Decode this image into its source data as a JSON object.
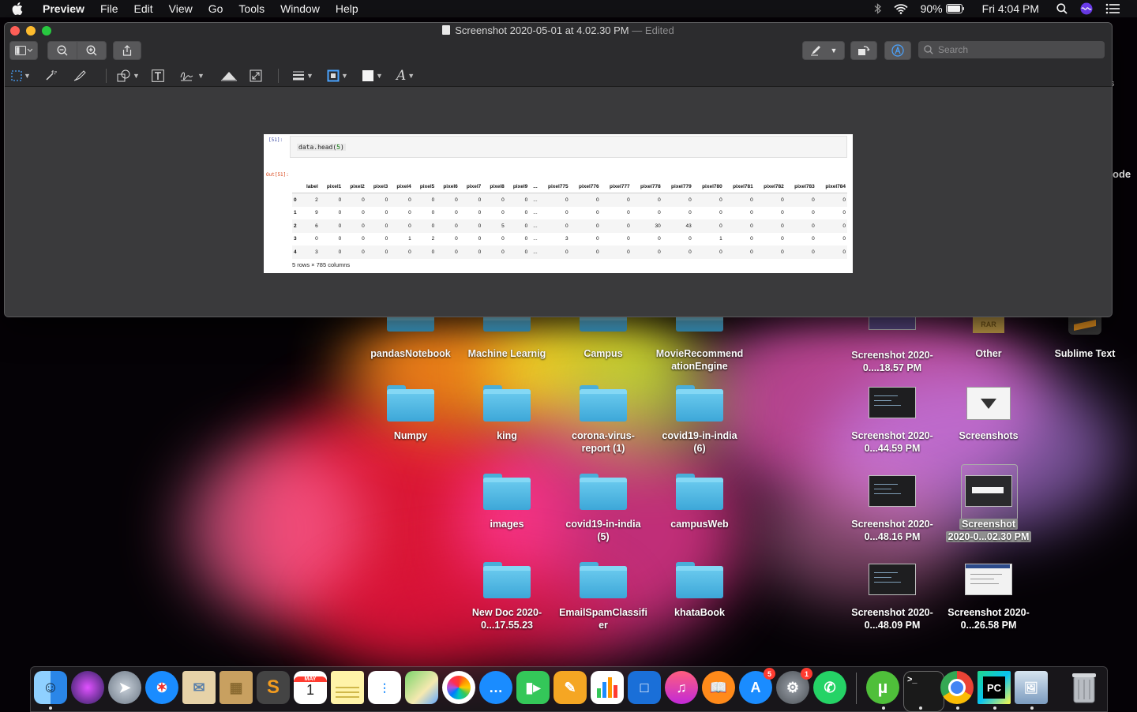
{
  "menubar": {
    "app": "Preview",
    "items": [
      "File",
      "Edit",
      "View",
      "Go",
      "Tools",
      "Window",
      "Help"
    ],
    "battery": "90%",
    "clock": "Fri 4:04 PM"
  },
  "window": {
    "title": "Screenshot 2020-05-01 at 4.02.30 PM",
    "edited": "— Edited",
    "search_placeholder": "Search"
  },
  "notebook": {
    "in_label": "[51]:",
    "code_fn": "data.head(",
    "code_num": "5",
    "code_end": ")",
    "out_label": "Out[51]:",
    "columns": [
      "",
      "label",
      "pixel1",
      "pixel2",
      "pixel3",
      "pixel4",
      "pixel5",
      "pixel6",
      "pixel7",
      "pixel8",
      "pixel9",
      "...",
      "pixel775",
      "pixel776",
      "pixel777",
      "pixel778",
      "pixel779",
      "pixel780",
      "pixel781",
      "pixel782",
      "pixel783",
      "pixel784"
    ],
    "rows": [
      [
        "0",
        "2",
        "0",
        "0",
        "0",
        "0",
        "0",
        "0",
        "0",
        "0",
        "0",
        "...",
        "0",
        "0",
        "0",
        "0",
        "0",
        "0",
        "0",
        "0",
        "0",
        "0"
      ],
      [
        "1",
        "9",
        "0",
        "0",
        "0",
        "0",
        "0",
        "0",
        "0",
        "0",
        "0",
        "...",
        "0",
        "0",
        "0",
        "0",
        "0",
        "0",
        "0",
        "0",
        "0",
        "0"
      ],
      [
        "2",
        "6",
        "0",
        "0",
        "0",
        "0",
        "0",
        "0",
        "0",
        "5",
        "0",
        "...",
        "0",
        "0",
        "0",
        "30",
        "43",
        "0",
        "0",
        "0",
        "0",
        "0"
      ],
      [
        "3",
        "0",
        "0",
        "0",
        "0",
        "1",
        "2",
        "0",
        "0",
        "0",
        "0",
        "...",
        "3",
        "0",
        "0",
        "0",
        "0",
        "1",
        "0",
        "0",
        "0",
        "0"
      ],
      [
        "4",
        "3",
        "0",
        "0",
        "0",
        "0",
        "0",
        "0",
        "0",
        "0",
        "0",
        "...",
        "0",
        "0",
        "0",
        "0",
        "0",
        "0",
        "0",
        "0",
        "0",
        "0"
      ]
    ],
    "rowcount": "5 rows × 785 columns"
  },
  "desktop": {
    "edge_text": "ode",
    "edge_s": "s",
    "items": [
      {
        "label": "pandasNotebook",
        "kind": "folder"
      },
      {
        "label": "Machine Learnig",
        "kind": "folder"
      },
      {
        "label": "Campus",
        "kind": "folder"
      },
      {
        "label": "MovieRecommend ationEngine",
        "kind": "folder"
      },
      {
        "label": "Screenshot 2020-0....18.57 PM",
        "kind": "screenshot"
      },
      {
        "label": "Other",
        "kind": "rar"
      },
      {
        "label": "Sublime Text",
        "kind": "app"
      },
      {
        "label": "Numpy",
        "kind": "folder"
      },
      {
        "label": "king",
        "kind": "folder"
      },
      {
        "label": "corona-virus- report (1)",
        "kind": "folder"
      },
      {
        "label": "covid19-in-india (6)",
        "kind": "folder"
      },
      {
        "label": "Screenshot 2020-0...44.59 PM",
        "kind": "screenshot"
      },
      {
        "label": "Screenshots",
        "kind": "folder-special"
      },
      {
        "label": "images",
        "kind": "folder"
      },
      {
        "label": "covid19-in-india (5)",
        "kind": "folder"
      },
      {
        "label": "campusWeb",
        "kind": "folder"
      },
      {
        "label": "Screenshot 2020-0...48.16 PM",
        "kind": "screenshot"
      },
      {
        "label_line1": "Screenshot",
        "label_line2": "2020-0...02.30 PM",
        "kind": "screenshot-selected"
      },
      {
        "label": "New Doc 2020-0...17.55.23",
        "kind": "folder"
      },
      {
        "label": "EmailSpamClassifi er",
        "kind": "folder"
      },
      {
        "label": "khataBook",
        "kind": "folder"
      },
      {
        "label": "Screenshot 2020-0...48.09 PM",
        "kind": "screenshot"
      },
      {
        "label": "Screenshot 2020-0...26.58 PM",
        "kind": "screenshot"
      }
    ]
  },
  "dock": {
    "calendar_month": "MAY",
    "calendar_day": "1",
    "appstore_badge": "5",
    "prefs_badge": "1",
    "apps": [
      "finder-icon",
      "siri-icon",
      "launchpad-icon",
      "safari-icon",
      "mail-icon",
      "contacts-icon",
      "sublime-icon",
      "calendar-icon",
      "notes-icon",
      "reminders-icon",
      "maps-icon",
      "photos-icon",
      "messages-icon",
      "facetime-icon",
      "pages-icon",
      "numbers-icon",
      "keynote-icon",
      "music-icon",
      "books-icon",
      "app-store-icon",
      "system-preferences-icon",
      "whatsapp-icon",
      "utorrent-icon",
      "terminal-icon",
      "chrome-icon",
      "pycharm-icon",
      "preview-icon",
      "trash-icon"
    ]
  }
}
